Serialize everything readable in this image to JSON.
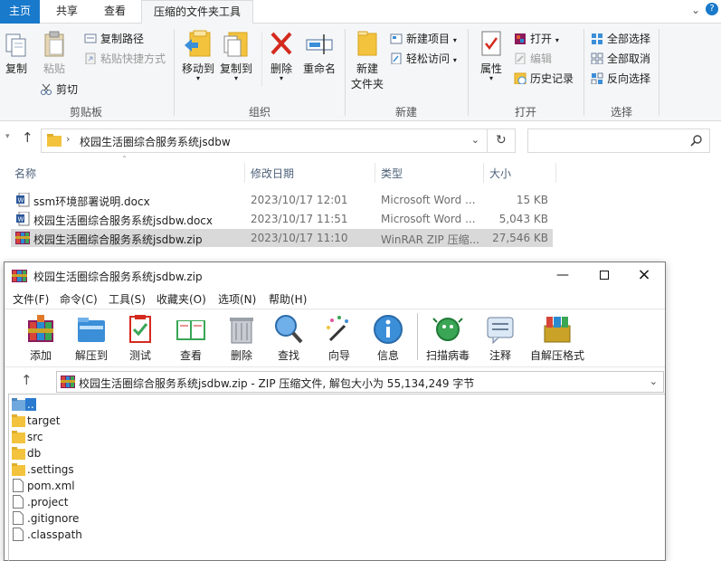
{
  "explorer": {
    "tabs": [
      "主页",
      "共享",
      "查看",
      "压缩的文件夹工具"
    ],
    "ribbon": {
      "clipboard": {
        "copy": "复制",
        "paste": "粘贴",
        "copy_path": "复制路径",
        "paste_shortcut": "粘贴快捷方式",
        "cut": "剪切",
        "label": "剪贴板"
      },
      "organize": {
        "move_to": "移动到",
        "copy_to": "复制到",
        "delete": "删除",
        "rename": "重命名",
        "label": "组织"
      },
      "new": {
        "new_folder": "新建\n文件夹",
        "new_folder_1": "新建",
        "new_folder_2": "文件夹",
        "new_item": "新建项目",
        "easy_access": "轻松访问",
        "label": "新建"
      },
      "open": {
        "properties": "属性",
        "open": "打开",
        "edit": "编辑",
        "history": "历史记录",
        "label": "打开"
      },
      "select": {
        "select_all": "全部选择",
        "select_none": "全部取消",
        "invert": "反向选择",
        "label": "选择"
      }
    },
    "address": {
      "path": "校园生活圈综合服务系统jsdbw"
    },
    "columns": {
      "name": "名称",
      "date": "修改日期",
      "type": "类型",
      "size": "大小"
    },
    "files": [
      {
        "name": "ssm环境部署说明.docx",
        "date": "2023/10/17 12:01",
        "type": "Microsoft Word ...",
        "size": "15 KB"
      },
      {
        "name": "校园生活圈综合服务系统jsdbw.docx",
        "date": "2023/10/17 11:51",
        "type": "Microsoft Word ...",
        "size": "5,043 KB"
      },
      {
        "name": "校园生活圈综合服务系统jsdbw.zip",
        "date": "2023/10/17 11:10",
        "type": "WinRAR ZIP 压缩...",
        "size": "27,546 KB"
      }
    ]
  },
  "winrar": {
    "title": "校园生活圈综合服务系统jsdbw.zip",
    "menu": [
      "文件(F)",
      "命令(C)",
      "工具(S)",
      "收藏夹(O)",
      "选项(N)",
      "帮助(H)"
    ],
    "toolbar": [
      "添加",
      "解压到",
      "测试",
      "查看",
      "删除",
      "查找",
      "向导",
      "信息",
      "扫描病毒",
      "注释",
      "自解压格式"
    ],
    "path": "校园生活圈综合服务系统jsdbw.zip - ZIP 压缩文件, 解包大小为 55,134,249 字节",
    "entries": [
      "..",
      "target",
      "src",
      "db",
      ".settings",
      "pom.xml",
      ".project",
      ".gitignore",
      ".classpath"
    ]
  },
  "colors": {
    "file_tab": "#1979ca",
    "selection": "#d9d9d9",
    "folder": "#f3c33e",
    "delete_red": "#d42a1e"
  }
}
